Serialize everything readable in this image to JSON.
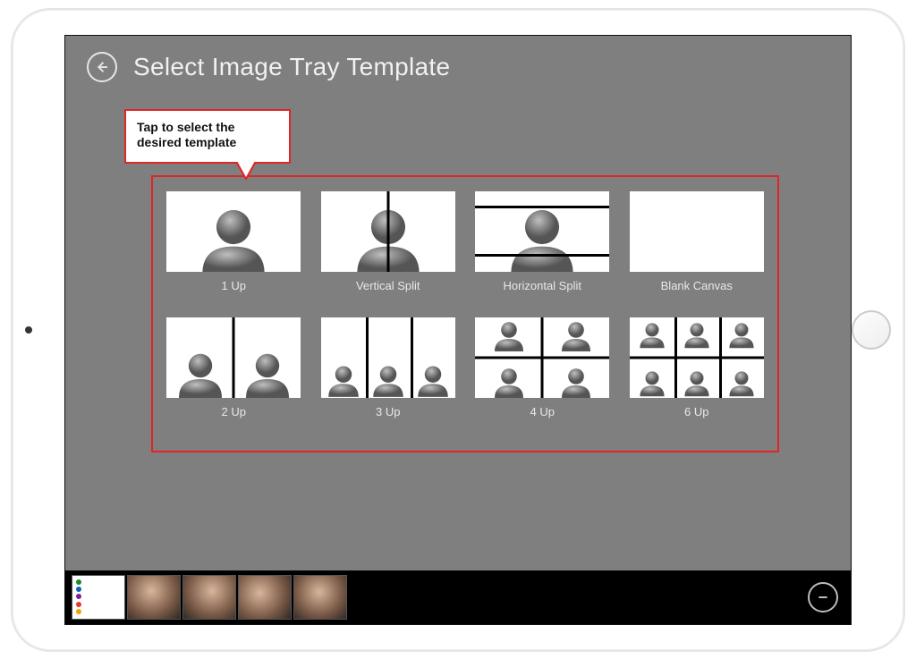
{
  "header": {
    "title": "Select Image Tray Template"
  },
  "callout": {
    "text": "Tap to select the desired template"
  },
  "templates": [
    {
      "label": "1 Up"
    },
    {
      "label": "Vertical Split"
    },
    {
      "label": "Horizontal Split"
    },
    {
      "label": "Blank Canvas"
    },
    {
      "label": "2 Up"
    },
    {
      "label": "3 Up"
    },
    {
      "label": "4 Up"
    },
    {
      "label": "6 Up"
    }
  ],
  "tray": {
    "color_dots": [
      "#1a8a2b",
      "#0b63b5",
      "#7b1fa2",
      "#e53935",
      "#f5a300"
    ]
  },
  "colors": {
    "highlight": "#e02525",
    "app_bg": "#7f7f7f"
  }
}
